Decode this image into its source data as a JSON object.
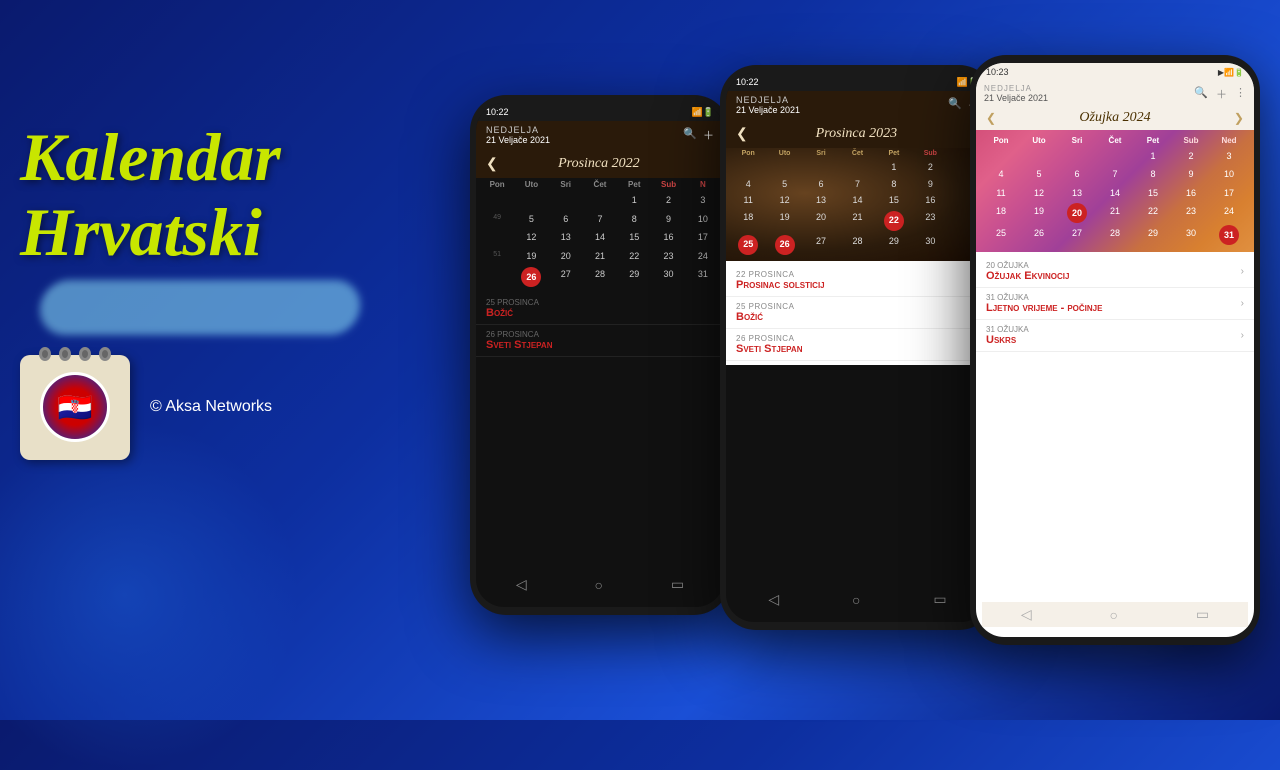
{
  "background": {
    "gradient": "linear-gradient(135deg, #0a1a6e 0%, #0d2fa0 40%, #1a4fd6 70%, #0a1a6e 100%)"
  },
  "left": {
    "title_line1": "Kalendar",
    "title_line2": "Hrvatski",
    "copyright": "© Aksa Networks"
  },
  "phone1": {
    "status": "10:22",
    "header_day": "Nedjelja",
    "header_date": "21 Veljače 2021",
    "month_title": "Prosinca 2022",
    "day_headers": [
      "Pon",
      "Uto",
      "Sri",
      "Čet",
      "Pet",
      "Sub",
      "N"
    ],
    "weeks": [
      [
        "",
        "",
        "",
        "1",
        "2",
        "3",
        ""
      ],
      [
        "49",
        "5",
        "6",
        "7",
        "8",
        "9",
        "10"
      ],
      [
        "",
        "12",
        "13",
        "14",
        "15",
        "16",
        "17"
      ],
      [
        "51",
        "19",
        "20",
        "21",
        "22",
        "23",
        "24"
      ],
      [
        "",
        "26",
        "27",
        "28",
        "29",
        "30",
        "31"
      ]
    ],
    "today_cells": [
      "26"
    ],
    "events": [
      {
        "date": "25 Prosinca",
        "name": "Božić"
      },
      {
        "date": "26 Prosinca",
        "name": "Sveti Stjepan"
      }
    ]
  },
  "phone2": {
    "status": "10:22",
    "header_day": "Nedjelja",
    "header_date": "21 Veljače 2021",
    "month_title": "Prosinca 2023",
    "day_headers": [
      "Pon",
      "Uto",
      "Sri",
      "Čet",
      "Pet",
      "Sub",
      ""
    ],
    "weeks": [
      [
        "",
        "",
        "",
        "",
        "1",
        "2",
        ""
      ],
      [
        "",
        "4",
        "5",
        "6",
        "7",
        "8",
        "9"
      ],
      [
        "",
        "11",
        "12",
        "13",
        "14",
        "15",
        "16"
      ],
      [
        "",
        "18",
        "19",
        "20",
        "21",
        "22",
        "23"
      ],
      [
        "",
        "25",
        "26",
        "27",
        "28",
        "29",
        "30"
      ]
    ],
    "today_cells": [
      "22",
      "25",
      "26"
    ],
    "events": [
      {
        "date": "22 Prosinca",
        "name": "Prosinac solsticij"
      },
      {
        "date": "25 Prosinca",
        "name": "Božić"
      },
      {
        "date": "26 Prosinca",
        "name": "Sveti Stjepan"
      }
    ]
  },
  "phone3": {
    "status": "10:23",
    "header_day": "Nedjelja",
    "header_date": "21 Veljače 2021",
    "month_title": "Ožujka 2024",
    "day_headers_main": [
      "Pon",
      "Uto",
      "Sri",
      "Čet",
      "Pet",
      "Sub",
      "Ned"
    ],
    "weeks": [
      [
        "",
        "",
        "",
        "",
        "1",
        "2",
        "3"
      ],
      [
        "4",
        "5",
        "6",
        "7",
        "8",
        "9",
        "10"
      ],
      [
        "11",
        "12",
        "13",
        "14",
        "15",
        "16",
        "17"
      ],
      [
        "18",
        "19",
        "20",
        "21",
        "22",
        "23",
        "24"
      ],
      [
        "25",
        "26",
        "27",
        "28",
        "29",
        "30",
        "31"
      ]
    ],
    "today_cell": "20",
    "red_cells": [
      "31"
    ],
    "events": [
      {
        "date": "20 Ožujka",
        "name": "Ožujak Ekvinocij"
      },
      {
        "date": "31 Ožujka",
        "name": "Ljetno vrijeme - počinje"
      },
      {
        "date": "31 Ožujka",
        "name": "Uskrs"
      }
    ]
  }
}
